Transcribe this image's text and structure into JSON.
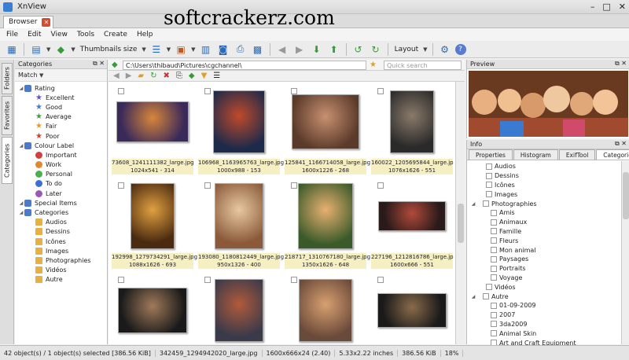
{
  "watermark": "softcrackerz.com",
  "window": {
    "title": "XnView"
  },
  "doc_tab": {
    "label": "Browser"
  },
  "menu": [
    "File",
    "Edit",
    "View",
    "Tools",
    "Create",
    "Help"
  ],
  "toolbar": {
    "thumb_size_label": "Thumbnails size",
    "layout_label": "Layout"
  },
  "left_tabs": [
    "Folders",
    "Favorites",
    "Categories"
  ],
  "categories_panel": {
    "title": "Categories",
    "match_label": "Match",
    "tree": [
      {
        "label": "Rating",
        "level": 0,
        "icon": "rating-icon"
      },
      {
        "label": "Excellent",
        "level": 1,
        "icon": "star-icon",
        "color": "#6a4fc8"
      },
      {
        "label": "Good",
        "level": 1,
        "icon": "star-icon",
        "color": "#3e7ad6"
      },
      {
        "label": "Average",
        "level": 1,
        "icon": "star-icon",
        "color": "#3aa044"
      },
      {
        "label": "Fair",
        "level": 1,
        "icon": "star-icon",
        "color": "#e0a020"
      },
      {
        "label": "Poor",
        "level": 1,
        "icon": "star-icon",
        "color": "#d83c2c"
      },
      {
        "label": "Colour Label",
        "level": 0,
        "icon": "palette-icon"
      },
      {
        "label": "Important",
        "level": 1,
        "icon": "dot-icon",
        "color": "#d04040"
      },
      {
        "label": "Work",
        "level": 1,
        "icon": "dot-icon",
        "color": "#e08a30"
      },
      {
        "label": "Personal",
        "level": 1,
        "icon": "dot-icon",
        "color": "#4caf50"
      },
      {
        "label": "To do",
        "level": 1,
        "icon": "dot-icon",
        "color": "#3a6fd8"
      },
      {
        "label": "Later",
        "level": 1,
        "icon": "dot-icon",
        "color": "#9b59b6"
      },
      {
        "label": "Special Items",
        "level": 0,
        "icon": "folder-icon"
      },
      {
        "label": "Categories",
        "level": 0,
        "icon": "folder-icon"
      },
      {
        "label": "Audios",
        "level": 1,
        "icon": "tag-icon"
      },
      {
        "label": "Dessins",
        "level": 1,
        "icon": "tag-icon"
      },
      {
        "label": "Icônes",
        "level": 1,
        "icon": "tag-icon"
      },
      {
        "label": "Images",
        "level": 1,
        "icon": "tag-icon"
      },
      {
        "label": "Photographies",
        "level": 1,
        "icon": "tag-icon"
      },
      {
        "label": "Vidéos",
        "level": 1,
        "icon": "tag-icon"
      },
      {
        "label": "Autre",
        "level": 1,
        "icon": "tag-icon"
      }
    ]
  },
  "browser": {
    "path": "C:\\Users\\thibaud\\Pictures\\cgchannel\\",
    "search_placeholder": "Quick search",
    "thumbnails": [
      {
        "name": "73608_1241111382_large.jpg",
        "info": "1024x541 - 314",
        "colors": [
          "#3a2a5a",
          "#d8863a"
        ]
      },
      {
        "name": "106968_1163965763_large.jpg",
        "info": "1000x988 - 153",
        "colors": [
          "#1e2a4a",
          "#c04a2a"
        ]
      },
      {
        "name": "125841_1166714058_large.jpg",
        "info": "1600x1226 - 268",
        "colors": [
          "#5a3a2a",
          "#c89070"
        ]
      },
      {
        "name": "160022_1205695844_large.jpg",
        "info": "1076x1626 - 551",
        "colors": [
          "#2a2a2a",
          "#8a7a6a"
        ]
      },
      {
        "name": "192998_1279734291_large.jpg",
        "info": "1088x1626 - 693",
        "colors": [
          "#4a2a10",
          "#e0a040"
        ]
      },
      {
        "name": "193080_1180812449_large.jpg",
        "info": "950x1326 - 400",
        "colors": [
          "#8a5a3a",
          "#e8c8a0"
        ]
      },
      {
        "name": "218717_1310767180_large.jpg",
        "info": "1350x1626 - 648",
        "colors": [
          "#3a5a2a",
          "#e8b070"
        ]
      },
      {
        "name": "227196_1212816786_large.jpg",
        "info": "1600x666 - 551",
        "colors": [
          "#2a1a1a",
          "#b04a3a"
        ]
      },
      {
        "name": "",
        "info": "",
        "colors": [
          "#1a1a1a",
          "#a07a5a"
        ]
      },
      {
        "name": "",
        "info": "",
        "colors": [
          "#3a3a4a",
          "#b05a3a"
        ]
      },
      {
        "name": "",
        "info": "",
        "colors": [
          "#6a4a3a",
          "#d8a070"
        ]
      },
      {
        "name": "",
        "info": "",
        "colors": [
          "#1a1a1a",
          "#8a6a4a"
        ]
      }
    ]
  },
  "preview": {
    "title": "Preview"
  },
  "info_panel": {
    "title": "Info",
    "tabs": [
      "Properties",
      "Histogram",
      "ExifTool",
      "Categories"
    ],
    "list": [
      {
        "label": "Audios",
        "level": 1
      },
      {
        "label": "Dessins",
        "level": 1
      },
      {
        "label": "Icônes",
        "level": 1
      },
      {
        "label": "Images",
        "level": 1
      },
      {
        "label": "Photographies",
        "level": 1,
        "expand": true
      },
      {
        "label": "Amis",
        "level": 2
      },
      {
        "label": "Animaux",
        "level": 2
      },
      {
        "label": "Famille",
        "level": 2
      },
      {
        "label": "Fleurs",
        "level": 2
      },
      {
        "label": "Mon animal",
        "level": 2
      },
      {
        "label": "Paysages",
        "level": 2
      },
      {
        "label": "Portraits",
        "level": 2
      },
      {
        "label": "Voyage",
        "level": 2
      },
      {
        "label": "Vidéos",
        "level": 1
      },
      {
        "label": "Autre",
        "level": 1,
        "expand": true
      },
      {
        "label": "01-09-2009",
        "level": 2
      },
      {
        "label": "2007",
        "level": 2
      },
      {
        "label": "3da2009",
        "level": 2
      },
      {
        "label": "Animal Skin",
        "level": 2
      },
      {
        "label": "Art and Craft Equipment",
        "level": 2
      }
    ]
  },
  "status": {
    "selection": "42 object(s) / 1 object(s) selected [386.56 KiB]",
    "filename": "342459_1294942020_large.jpg",
    "dimensions": "1600x666x24 (2.40)",
    "size_inches": "5.33x2.22 inches",
    "filesize": "386.56 KiB",
    "zoom": "18%"
  }
}
